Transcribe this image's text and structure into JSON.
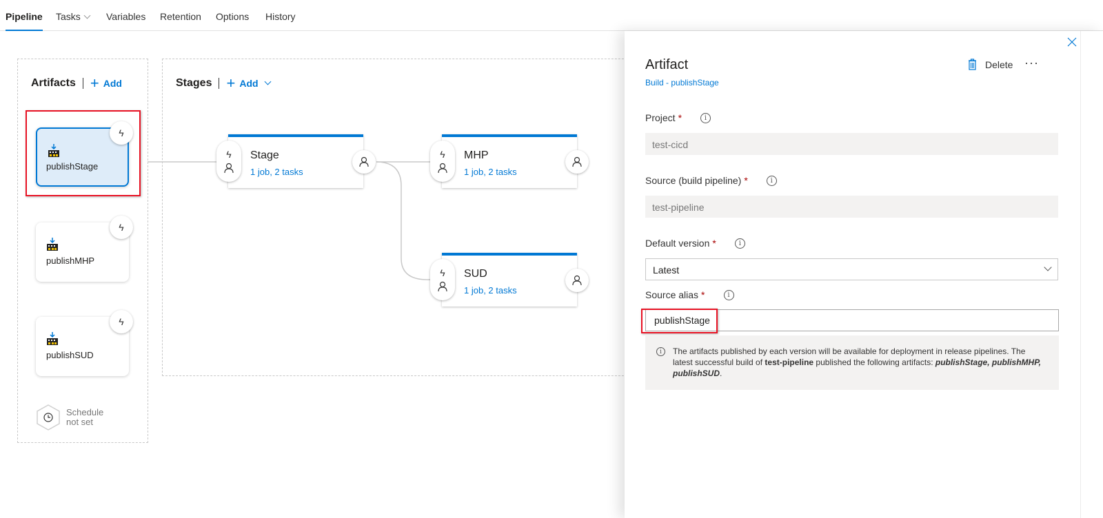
{
  "tabs": [
    {
      "label": "Pipeline",
      "active": true
    },
    {
      "label": "Tasks",
      "has_dropdown": true
    },
    {
      "label": "Variables"
    },
    {
      "label": "Retention"
    },
    {
      "label": "Options"
    },
    {
      "label": "History"
    }
  ],
  "artifacts_section": {
    "title": "Artifacts",
    "add_label": "Add",
    "items": [
      {
        "name": "publishStage",
        "selected": true
      },
      {
        "name": "publishMHP",
        "selected": false
      },
      {
        "name": "publishSUD",
        "selected": false
      }
    ],
    "schedule": {
      "line1": "Schedule",
      "line2": "not set"
    }
  },
  "stages_section": {
    "title": "Stages",
    "add_label": "Add",
    "items": [
      {
        "name": "Stage",
        "summary": "1 job, 2 tasks"
      },
      {
        "name": "MHP",
        "summary": "1 job, 2 tasks"
      },
      {
        "name": "SUD",
        "summary": "1 job, 2 tasks"
      }
    ]
  },
  "panel": {
    "title": "Artifact",
    "subtitle": "Build - publishStage",
    "delete_label": "Delete",
    "more_label": "···",
    "fields": {
      "project": {
        "label": "Project",
        "value": "test-cicd"
      },
      "source": {
        "label": "Source (build pipeline)",
        "value": "test-pipeline"
      },
      "default_version": {
        "label": "Default version",
        "value": "Latest"
      },
      "source_alias": {
        "label": "Source alias",
        "value": "publishStage"
      }
    },
    "required_marker": "*",
    "info": {
      "text_1": "The artifacts published by each version will be available for deployment in release pipelines. The latest successful build of ",
      "pipeline": "test-pipeline",
      "text_2": "  published the following artifacts: ",
      "artifacts": "publishStage, publishMHP, publishSUD",
      "text_3": "."
    }
  },
  "colors": {
    "accent": "#0078d4",
    "highlight_box": "#e81123",
    "selected_card_bg": "#deecf9",
    "required": "#a80000"
  }
}
